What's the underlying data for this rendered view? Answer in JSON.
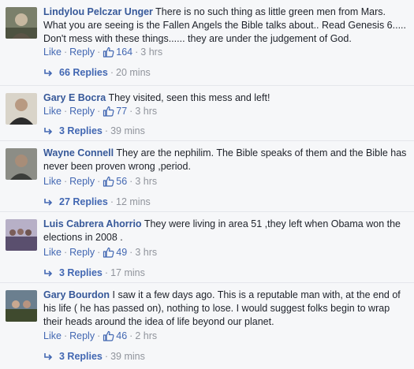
{
  "actions": {
    "like_label": "Like",
    "reply_label": "Reply",
    "separator": "·"
  },
  "icons": {
    "thumb": "thumbs-up-icon",
    "reply": "reply-arrow-icon"
  },
  "colors": {
    "link": "#4267b2",
    "author": "#365899",
    "meta": "#90949c",
    "text": "#1d2129"
  },
  "comments": [
    {
      "author": "Lindylou Pelczar Unger",
      "text": "There is no such thing as little green men from Mars. What you are seeing is the Fallen Angels the Bible talks about.. Read Genesis 6..... Don't mess with these things...... they are under the judgement of God.",
      "likes": "164",
      "time": "3 hrs",
      "replies": "66 Replies",
      "replies_time": "20 mins"
    },
    {
      "author": "Gary E Bocra",
      "text": "They visited, seen this mess and left!",
      "likes": "77",
      "time": "3 hrs",
      "replies": "3 Replies",
      "replies_time": "39 mins"
    },
    {
      "author": "Wayne Connell",
      "text": "They are the nephilim. The Bible speaks of them and the Bible has never been proven wrong ,period.",
      "likes": "56",
      "time": "3 hrs",
      "replies": "27 Replies",
      "replies_time": "12 mins"
    },
    {
      "author": "Luis Cabrera Ahorrio",
      "text": "They were living in area 51 ,they left when Obama won the elections in 2008 .",
      "likes": "49",
      "time": "3 hrs",
      "replies": "3 Replies",
      "replies_time": "17 mins"
    },
    {
      "author": "Gary Bourdon",
      "text": "I saw it a few days ago. This is a reputable man with, at the end of his life ( he has passed on), nothing to lose. I would suggest folks begin to wrap their heads around the idea of life beyond our planet.",
      "likes": "46",
      "time": "2 hrs",
      "replies": "3 Replies",
      "replies_time": "39 mins"
    }
  ]
}
